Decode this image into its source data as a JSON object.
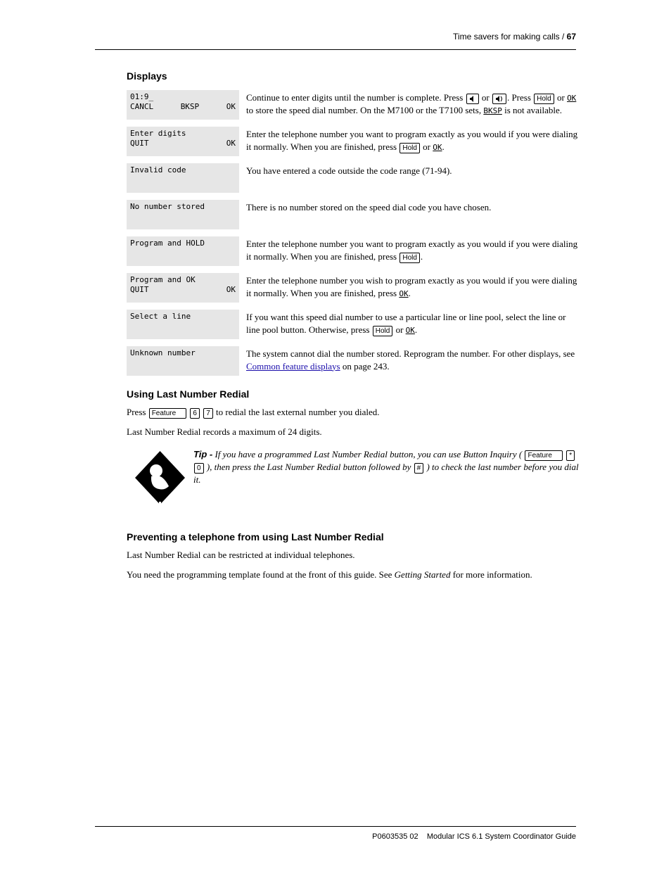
{
  "page": {
    "number": "67",
    "breadcrumb": "Time savers for making calls /",
    "footer": "Modular ICS 6.1 System Coordinator Guide",
    "footer_code": "P0603535  02"
  },
  "sections": {
    "displays_title": "Displays",
    "last_num_title": "Using Last Number Redial",
    "last_num_keys": {
      "feature": "Feature",
      "d1": "6",
      "d2": "7"
    },
    "last_num_para": "Press  to redial the last external number you dialed.",
    "last_num_para2": "Last Number Redial records a maximum of 24 digits.",
    "tip_label": "Tip -",
    "tip_text": "If you have a programmed Last Number Redial button, you can use Button Inquiry (",
    "tip_keys": {
      "feature": "Feature",
      "star": "*",
      "zero": "0"
    },
    "tip_text2": "), then press the Last Number Redial button followed by ",
    "tip_keys2": {
      "hash": "#"
    },
    "tip_text3": ") to check the last number before you dial it.",
    "prevent_title": "Preventing a telephone from using Last Number Redial",
    "prevent_para": "Last Number Redial can be restricted at individual telephones.",
    "prevent_para2": "You need the programming template found at the front of this guide. See ",
    "prevent_link": "Getting Started",
    "prevent_para2b": " for more information."
  },
  "lcd": {
    "r1": {
      "line1": "01:9_",
      "cancel": "CANCL",
      "bksp": "BKSP",
      "ok": "OK",
      "desc1": "Continue to enter digits until the number is complete. Press ",
      "desc_key1a": "Hold",
      "desc1b": " or ",
      "desc_soft_ok": "OK",
      "desc1c": " to store the speed dial number. On the M7100 or the T7100 sets, ",
      "desc_soft_bksp": "BKSP",
      "desc1d": " is not available."
    },
    "r2": {
      "line1": "Enter digits",
      "quit": "QUIT",
      "ok": "OK",
      "desc": "Enter the telephone number you want to program exactly as you would if you were dialing it normally. When you are finished, press ",
      "key_hold": "Hold",
      "desc2": " or ",
      "soft_ok": "OK",
      "desc3": "."
    },
    "r3": {
      "line1": "Invalid code",
      "desc": "You have entered a code outside the code range (71-94)."
    },
    "r4": {
      "line1": "No number stored",
      "desc": "There is no number stored on the speed dial code you have chosen."
    },
    "r5": {
      "line1": "Program and HOLD",
      "desc1": "Enter the telephone number you want to program exactly as you would if you were dialing it normally. When you are finished, press ",
      "key_hold": "Hold",
      "desc2": "."
    },
    "r6": {
      "line1": "Program and OK",
      "quit": "QUIT",
      "ok": "OK",
      "desc1": "Enter the telephone number you wish to program exactly as you would if you were dialing it normally. When you are finished, press ",
      "soft_ok": "OK",
      "desc2": "."
    },
    "r7": {
      "line1": "Select a line",
      "desc": "If you want this speed dial number to use a particular line or line pool, select the line or line pool button. Otherwise, press ",
      "key_hold": "Hold",
      "desc2": " or ",
      "soft_ok": "OK",
      "desc3": "."
    },
    "r8": {
      "line1": "Unknown number",
      "desc1": "The system cannot dial the number stored. Reprogram the number. For other displays, see ",
      "link": "Common feature displays",
      "desc2": " on page 243."
    }
  }
}
